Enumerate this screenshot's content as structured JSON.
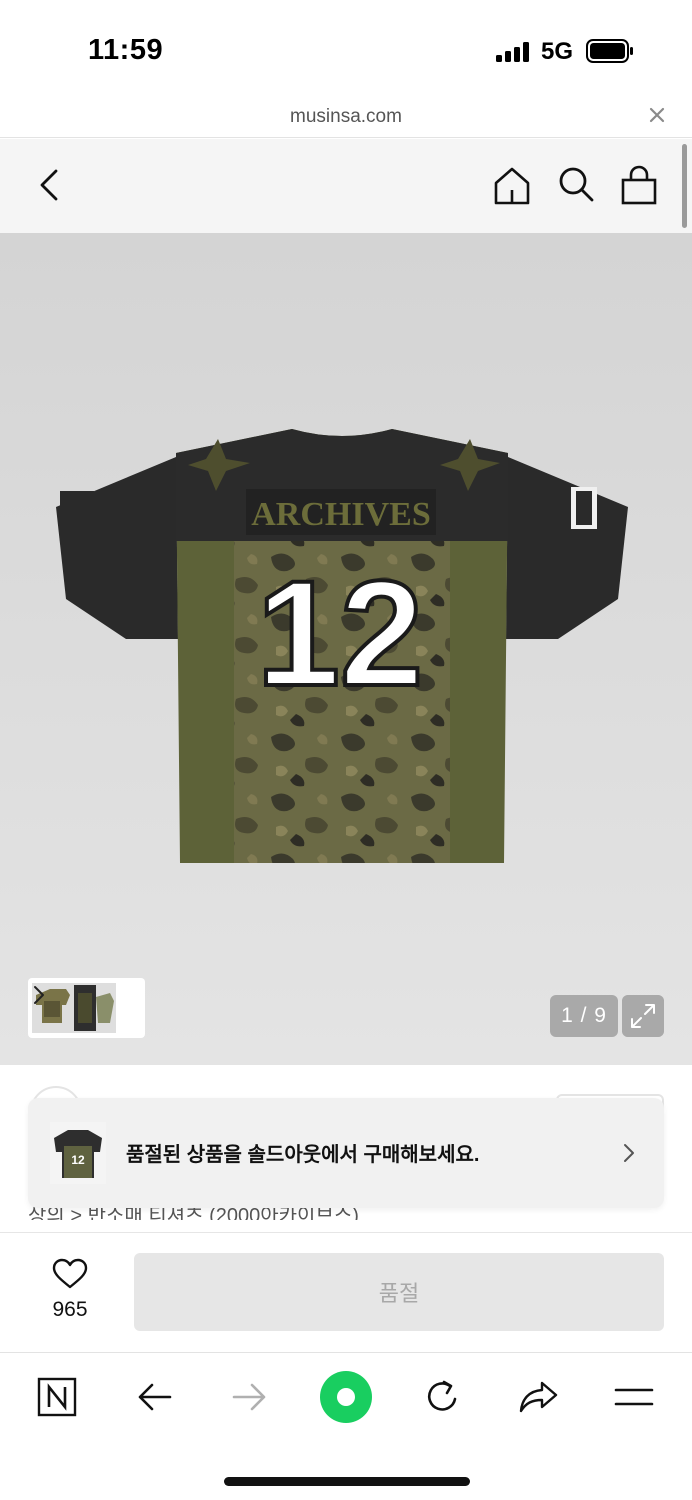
{
  "status_bar": {
    "time": "11:59",
    "network": "5G"
  },
  "browser": {
    "url": "musinsa.com"
  },
  "header": {
    "icons": [
      "back-icon",
      "home-icon",
      "search-icon",
      "shopping-bag-icon"
    ]
  },
  "product": {
    "jersey_patch_text": "ARCHIVES",
    "jersey_number": "12",
    "image_counter": "1 / 9"
  },
  "soldout_banner": {
    "text": "품절된 상품을 솔드아웃에서 구매해보세요."
  },
  "breadcrumb": {
    "text": "상의 > 반소매 티셔츠 (2000아카이브스)"
  },
  "purchase_bar": {
    "like_count": "965",
    "button_label": "품절"
  },
  "toolbar": {
    "icons": [
      "naver-n-icon",
      "back-arrow-icon",
      "forward-arrow-icon",
      "green-dot-icon",
      "refresh-icon",
      "share-icon",
      "menu-icon"
    ]
  },
  "colors": {
    "accent_green": "#19ce60",
    "jersey_black": "#2b2b2b",
    "jersey_olive": "#5d6238"
  }
}
